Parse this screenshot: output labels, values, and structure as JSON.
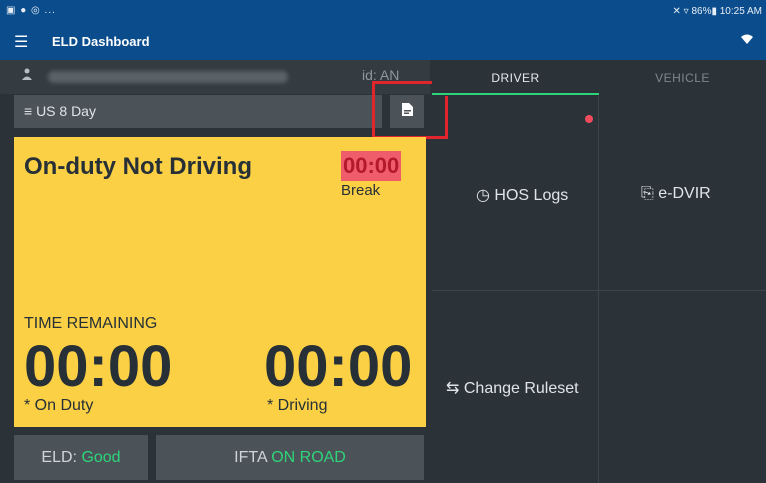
{
  "status_bar": {
    "left_icons": "▣ ● ◎ ...",
    "right": "✕ ▿ 86%▮ 10:25 AM"
  },
  "app_bar": {
    "title": "ELD Dashboard"
  },
  "driver": {
    "id_label": "id: AN"
  },
  "ruleset": {
    "label": "US 8 Day"
  },
  "status_card": {
    "status": "On-duty Not Driving",
    "break_time": "00:00",
    "break_label": "Break",
    "time_remaining_label": "TIME REMAINING",
    "on_duty_time": "00:00",
    "on_duty_label": "* On Duty",
    "driving_time": "00:00",
    "driving_label": "* Driving"
  },
  "footer": {
    "eld_label": "ELD:",
    "eld_value": "Good",
    "ifta_label": "IFTA",
    "ifta_value": "ON ROAD"
  },
  "tabs": {
    "driver": "DRIVER",
    "vehicle": "VEHICLE"
  },
  "actions": {
    "hos_logs": "HOS Logs",
    "e_dvir": "e-DVIR",
    "change_ruleset": "Change Ruleset"
  },
  "colors": {
    "accent_green": "#2ed47a",
    "app_bar": "#0b4d8c",
    "status_yellow": "#fbd045",
    "alert_red": "#e2242c"
  }
}
